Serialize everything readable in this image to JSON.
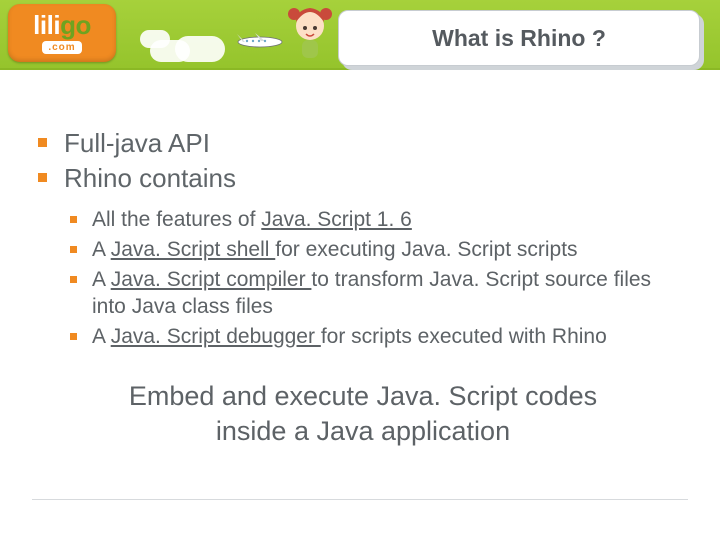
{
  "logo": {
    "name_part1": "lili",
    "name_part2": "go",
    "suffix": ".com"
  },
  "title": "What is Rhino ?",
  "bullets": [
    {
      "text": "Full-java API"
    },
    {
      "text": "Rhino contains"
    }
  ],
  "sub_bullets": [
    {
      "pre": "All the features of ",
      "u": "Java. Script 1. 6",
      "post": ""
    },
    {
      "pre": "A ",
      "u": "Java. Script shell ",
      "post": "for executing Java. Script scripts"
    },
    {
      "pre": "A ",
      "u": "Java. Script compiler ",
      "post": "to transform Java. Script source files into Java class files"
    },
    {
      "pre": "A ",
      "u": "Java. Script debugger ",
      "post": "for scripts executed with Rhino"
    }
  ],
  "summary_line1": "Embed and execute Java. Script codes",
  "summary_line2": "inside a Java application"
}
